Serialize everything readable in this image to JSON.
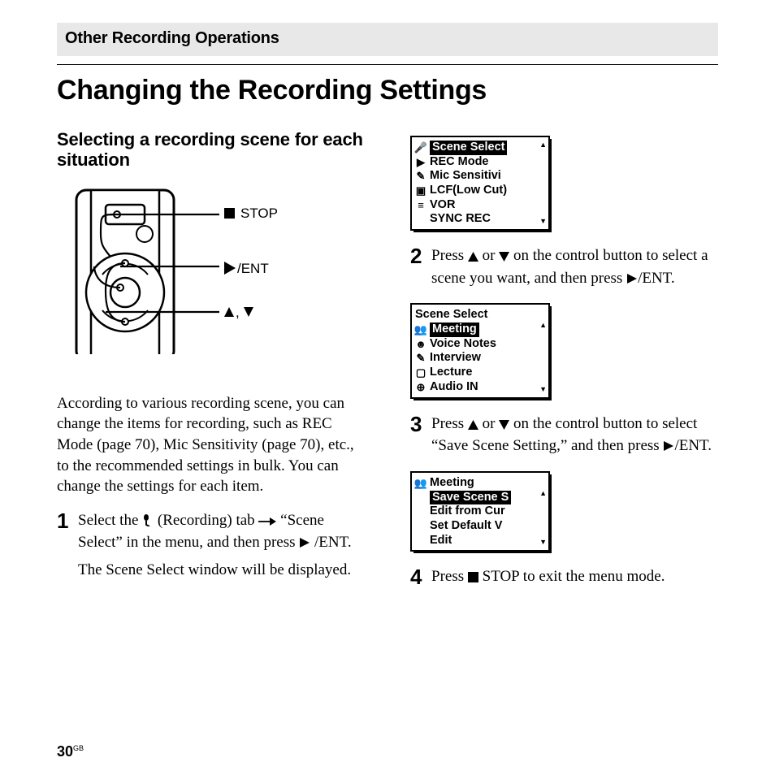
{
  "header": {
    "section_label": "Other Recording Operations"
  },
  "title": "Changing the Recording Settings",
  "left": {
    "subhead": "Selecting a recording scene for each situation",
    "diagram_labels": {
      "stop": "STOP",
      "ent": "/ENT",
      "updown": ","
    },
    "intro": "According to various recording scene, you can change the items for recording, such as REC Mode (page 70), Mic Sensitivity (page 70), etc., to the recommended settings in bulk. You can change the settings for each item.",
    "step1": {
      "num": "1",
      "text_a": "Select the ",
      "text_b": " (Recording) tab ",
      "text_c": " “Scene Select” in the menu, and then press ",
      "text_d": "/ENT.",
      "sub": "The Scene Select window will be displayed."
    }
  },
  "right": {
    "lcd1": {
      "r0_sel": "Scene Select",
      "r1": "REC Mode",
      "r2": "Mic Sensitivi",
      "r3": "LCF(Low Cut)",
      "r4": "VOR",
      "r5": "SYNC REC"
    },
    "step2": {
      "num": "2",
      "text_a": "Press ",
      "text_b": " or ",
      "text_c": " on the control button to select a scene you want, and then press ",
      "text_d": "/ENT."
    },
    "lcd2": {
      "title": "Scene Select",
      "r1_sel": "Meeting",
      "r2": "Voice Notes",
      "r3": "Interview",
      "r4": "Lecture",
      "r5": "Audio IN"
    },
    "step3": {
      "num": "3",
      "text_a": "Press ",
      "text_b": " or ",
      "text_c": " on the control button to select “Save Scene Setting,” and then press ",
      "text_d": "/ENT."
    },
    "lcd3": {
      "title": "Meeting",
      "r1_sel": "Save Scene S",
      "r2": "Edit from Cur",
      "r3": "Set Default V",
      "r4": "Edit"
    },
    "step4": {
      "num": "4",
      "text_a": "Press ",
      "text_b": " STOP to exit the menu mode."
    }
  },
  "footer": {
    "page": "30",
    "region": "GB"
  }
}
